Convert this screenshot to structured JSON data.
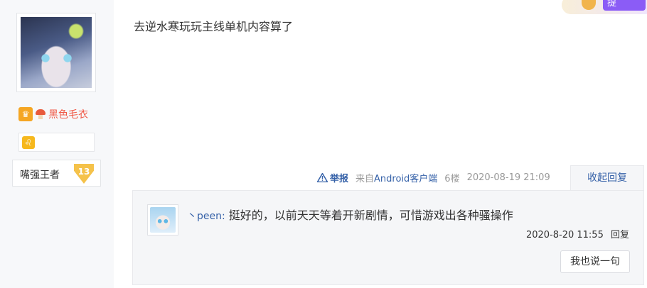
{
  "author": {
    "avatar_name": "avatar",
    "username": "黑色毛衣",
    "level_title": "嘴强王者",
    "level": "13"
  },
  "post": {
    "content": "去逆水寒玩玩主线单机内容算了",
    "report_label": "举报",
    "client_prefix": "来自",
    "client_name": "Android客户端",
    "floor": "6楼",
    "datetime": "2020-08-19 21:09",
    "collapse_label": "收起回复"
  },
  "header": {
    "tag_label": "提"
  },
  "reply": {
    "username": "丶peen:",
    "content": "挺好的，以前天天等着开新剧情，可惜游戏出各种骚操作",
    "datetime": "2020-8-20 11:55",
    "reply_label": "回复",
    "say_button_label": "我也说一句"
  },
  "colors": {
    "link": "#3561a8",
    "username": "#f05a48",
    "sidebar_bg": "#f7f8fa",
    "reply_bg": "#f5f6f8"
  }
}
